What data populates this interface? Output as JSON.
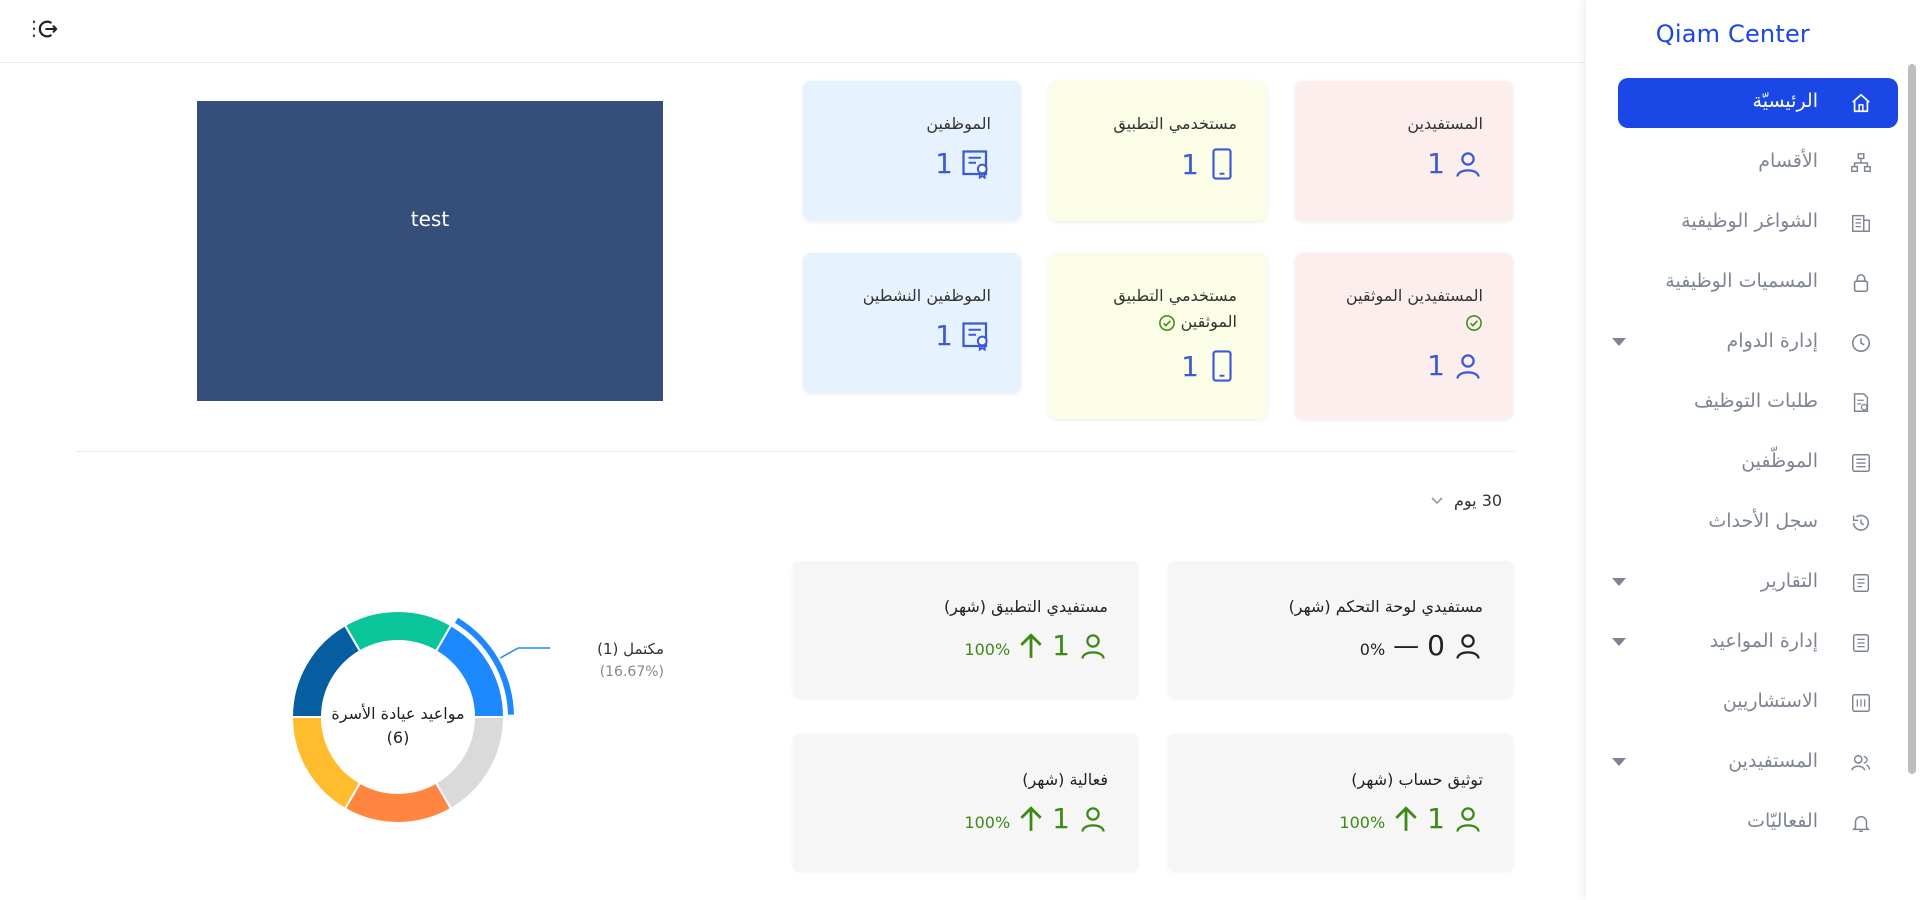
{
  "brand": "Qiam Center",
  "sidebar": {
    "items": [
      {
        "label": "الرئيسيّة",
        "icon": "home-icon",
        "active": true,
        "caret": false
      },
      {
        "label": "الأقسام",
        "icon": "sitemap-icon",
        "active": false,
        "caret": false
      },
      {
        "label": "الشواغر الوظيفية",
        "icon": "building-icon",
        "active": false,
        "caret": false
      },
      {
        "label": "المسميات الوظيفية",
        "icon": "lock-icon",
        "active": false,
        "caret": false
      },
      {
        "label": "إدارة الدوام",
        "icon": "clock-icon",
        "active": false,
        "caret": true
      },
      {
        "label": "طلبات التوظيف",
        "icon": "document-check-icon",
        "active": false,
        "caret": false
      },
      {
        "label": "الموظّفين",
        "icon": "list-icon",
        "active": false,
        "caret": false
      },
      {
        "label": "سجل الأحداث",
        "icon": "history-icon",
        "active": false,
        "caret": false
      },
      {
        "label": "التقارير",
        "icon": "report-icon",
        "active": false,
        "caret": true
      },
      {
        "label": "إدارة المواعيد",
        "icon": "calendar-doc-icon",
        "active": false,
        "caret": true
      },
      {
        "label": "الاستشاريين",
        "icon": "grid-icon",
        "active": false,
        "caret": false
      },
      {
        "label": "المستفيدين",
        "icon": "users-icon",
        "active": false,
        "caret": true
      },
      {
        "label": "الفعاليّات",
        "icon": "bell-icon",
        "active": false,
        "caret": false
      }
    ]
  },
  "stats": {
    "beneficiaries": {
      "title": "المستفيدين",
      "value": "1"
    },
    "app_users": {
      "title": "مستخدمي التطبيق",
      "value": "1"
    },
    "employees": {
      "title": "الموظفين",
      "value": "1"
    },
    "verified_beneficiaries": {
      "title": "المستفيدين الموثقين",
      "value": "1"
    },
    "verified_app_users": {
      "title_line1": "مستخدمي التطبيق",
      "title_line2": "الموثقين",
      "value": "1"
    },
    "active_employees": {
      "title": "الموظفين النشطين",
      "value": "1"
    }
  },
  "test_box": {
    "label": "test"
  },
  "period": {
    "label": "30 يوم"
  },
  "monthly": {
    "dashboard_beneficiaries": {
      "title": "مستفيدي لوحة التحكم (شهر)",
      "value": "0",
      "percent": "0%"
    },
    "app_beneficiaries": {
      "title": "مستفيدي التطبيق (شهر)",
      "value": "1",
      "percent": "100%"
    },
    "account_verification": {
      "title": "توثيق حساب (شهر)",
      "value": "1",
      "percent": "100%"
    },
    "activity": {
      "title": "فعالية (شهر)",
      "value": "1",
      "percent": "100%"
    }
  },
  "chart_data": {
    "type": "pie",
    "center_label": "مواعيد عيادة الأسرة",
    "center_value": "(6)",
    "slices": [
      {
        "label": "مكتمل",
        "value": 1,
        "color": "#1e88ff"
      },
      {
        "value": 1,
        "color": "#dadada"
      },
      {
        "value": 1,
        "color": "#ff8540"
      },
      {
        "value": 1,
        "color": "#ffbd2e"
      },
      {
        "value": 1,
        "color": "#065ea0"
      },
      {
        "value": 1,
        "color": "#0ac59a"
      }
    ],
    "highlighted": {
      "label": "مكتمل (1)",
      "percent": "(16.67%)"
    }
  },
  "colors": {
    "accent": "#1a47e6",
    "stat_icon": "#3c5ad6",
    "up": "#3a8a14"
  }
}
